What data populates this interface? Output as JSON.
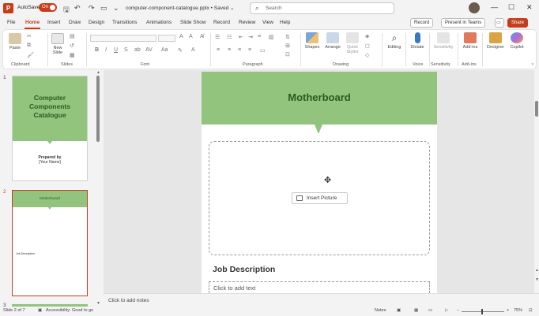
{
  "titlebar": {
    "autosave_label": "AutoSave",
    "autosave_state": "On",
    "filename": "computer-component-catalogue.pptx • Saved ⌄",
    "search_placeholder": "Search",
    "min": "—",
    "max": "☐",
    "close": "✕"
  },
  "tabs": [
    "File",
    "Home",
    "Insert",
    "Draw",
    "Design",
    "Transitions",
    "Animations",
    "Slide Show",
    "Record",
    "Review",
    "View",
    "Help"
  ],
  "tab_buttons": {
    "record": "Record",
    "present": "Present in Teams",
    "share": "Share"
  },
  "ribbon": {
    "paste": "Paste",
    "new_slide": "New Slide",
    "shapes": "Shapes",
    "arrange": "Arrange",
    "quick_styles": "Quick Styles",
    "editing": "Editing",
    "dictate": "Dictate",
    "sensitivity": "Sensitivity",
    "addins": "Add-ins",
    "designer": "Designer",
    "copilot": "Copilot",
    "groups": {
      "clipboard": "Clipboard",
      "slides": "Slides",
      "font": "Font",
      "paragraph": "Paragraph",
      "drawing": "Drawing",
      "voice": "Voice",
      "sensitivity": "Sensitivity",
      "addins": "Add-ins"
    }
  },
  "thumbnails": {
    "n1": "1",
    "n2": "2",
    "n3": "3",
    "t1_title": "Computer Components Catalogue",
    "t1_sub1": "Prepared by",
    "t1_sub2": "[Your Name]",
    "t2_title": "Motherboard",
    "t2_job": "Job Description"
  },
  "slide": {
    "title": "Motherboard",
    "insert_picture": "Insert Picture",
    "job_heading": "Job Description",
    "job_placeholder": "Click to add text"
  },
  "notes": "Click to add notes",
  "status": {
    "slide_of": "Slide 2 of 7",
    "accessibility": "Accessibility: Good to go",
    "notes_btn": "Notes",
    "zoom": "75%"
  },
  "colors": {
    "accent": "#c43e1c",
    "slide_green": "#92c47e",
    "title_green": "#2d5a1e"
  }
}
